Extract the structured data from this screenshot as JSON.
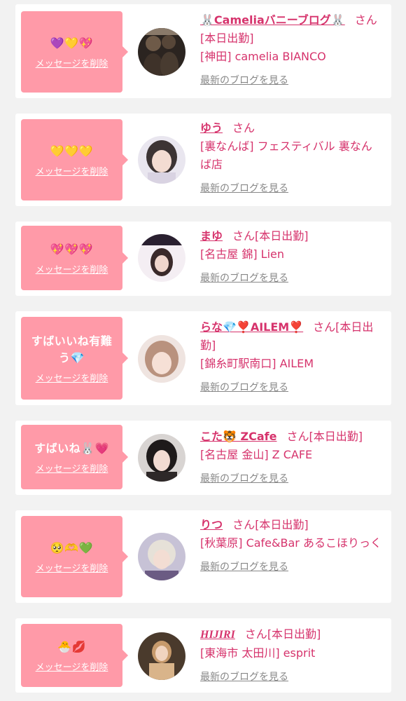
{
  "delete_label": "メッセージを削除",
  "blog_link_label": "最新のブログを見る",
  "honorific": "さん",
  "items": [
    {
      "message": "💜💛💖",
      "name": "🐰Cameliaバニーブログ🐰",
      "status": "[本日出勤]",
      "shop": "[神田] camelia BIANCO"
    },
    {
      "message": "💛💛💛",
      "name": "ゆう",
      "status": "",
      "shop": "[裏なんば] フェスティバル 裏なんば店"
    },
    {
      "message": "💖💖💖",
      "name": "まゆ",
      "status": "[本日出勤]",
      "shop": "[名古屋 錦] Lien"
    },
    {
      "message": "すばいいね有難う💎",
      "name": "らな💎❣️AILEM❣️",
      "status": "[本日出勤]",
      "shop": "[錦糸町駅南口] AILEM"
    },
    {
      "message": "すばいね🐰💗",
      "name": "こた🐯 ZCafe",
      "status": "[本日出勤]",
      "shop": "[名古屋 金山] Z CAFE"
    },
    {
      "message": "🥺🫶💚",
      "name": "りつ",
      "status": "[本日出勤]",
      "shop": "[秋葉原] Cafe&Bar あるこほりっく"
    },
    {
      "message": "🐣💋",
      "name": "HIJIRI",
      "status": "[本日出勤]",
      "shop": "[東海市 太田川] esprit"
    }
  ],
  "colors": {
    "background": "#f2f2f2",
    "bubble": "#ff9aa8",
    "accent": "#d6336c",
    "link_gray": "#888888"
  }
}
